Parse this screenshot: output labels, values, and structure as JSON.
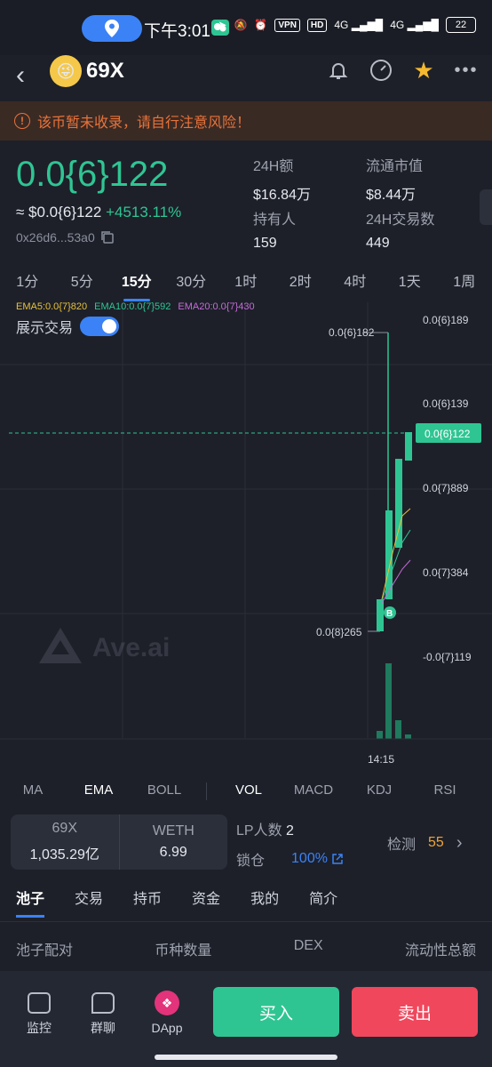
{
  "status": {
    "time": "下午3:01",
    "vpn": "VPN",
    "hd": "HD",
    "net1": "4G",
    "net2": "4G",
    "battery": "22"
  },
  "header": {
    "back": "‹",
    "title": "69X"
  },
  "warning": {
    "text": "该币暂未收录，请自行注意风险！"
  },
  "price": {
    "main": "0.0{6}122",
    "usd": "≈ $0.0{6}122",
    "change": "+4513.11%",
    "address": "0x26d6...53a0"
  },
  "stats": [
    {
      "label": "24H额",
      "value": "$16.84万"
    },
    {
      "label": "流通市值",
      "value": "$8.44万"
    },
    {
      "label": "持有人",
      "value": "159"
    },
    {
      "label": "24H交易数",
      "value": "449"
    }
  ],
  "timeframes": [
    "1分",
    "5分",
    "15分",
    "30分",
    "1时",
    "2时",
    "4时",
    "1天",
    "1周"
  ],
  "active_timeframe": "15分",
  "ema_legend": [
    {
      "text": "EMA5:0.0{7}820",
      "color": "#e8c13a"
    },
    {
      "text": "EMA10:0.0{7}592",
      "color": "#2fc593"
    },
    {
      "text": "EMA20:0.0{7}430",
      "color": "#c76bd8"
    }
  ],
  "toggle_label": "展示交易",
  "watermark": "Ave.ai",
  "chart_data": {
    "type": "candlestick",
    "y_axis_labels": [
      "0.0{6}189",
      "0.0{6}139",
      "0.0{7}889",
      "0.0{7}384",
      "-0.0{7}119"
    ],
    "current_price_label": "0.0{6}122",
    "high_label": "0.0{6}182",
    "low_label": "0.0{8}265",
    "x_label": "14:15",
    "trade_marker": "B",
    "colors": {
      "up": "#2fc593",
      "dashed": "#2fc593"
    }
  },
  "indicators": [
    "MA",
    "EMA",
    "BOLL",
    "VOL",
    "MACD",
    "KDJ",
    "RSI"
  ],
  "pool": {
    "token_a": "69X",
    "amount_a": "1,035.29亿",
    "token_b": "WETH",
    "amount_b": "6.99",
    "lp_label": "LP人数",
    "lp_count": "2",
    "lock_label": "锁仓",
    "lock_value": "100%",
    "check_label": "检测",
    "check_value": "55"
  },
  "section_tabs": [
    "池子",
    "交易",
    "持币",
    "资金",
    "我的",
    "简介"
  ],
  "pool_table_headers": [
    "池子配对",
    "币种数量",
    "DEX",
    "流动性总额"
  ],
  "bottom": {
    "nav": [
      {
        "label": "监控",
        "icon": "monitor-icon"
      },
      {
        "label": "群聊",
        "icon": "chat-icon"
      },
      {
        "label": "DApp",
        "icon": "dapp-icon"
      }
    ],
    "buy": "买入",
    "sell": "卖出"
  }
}
